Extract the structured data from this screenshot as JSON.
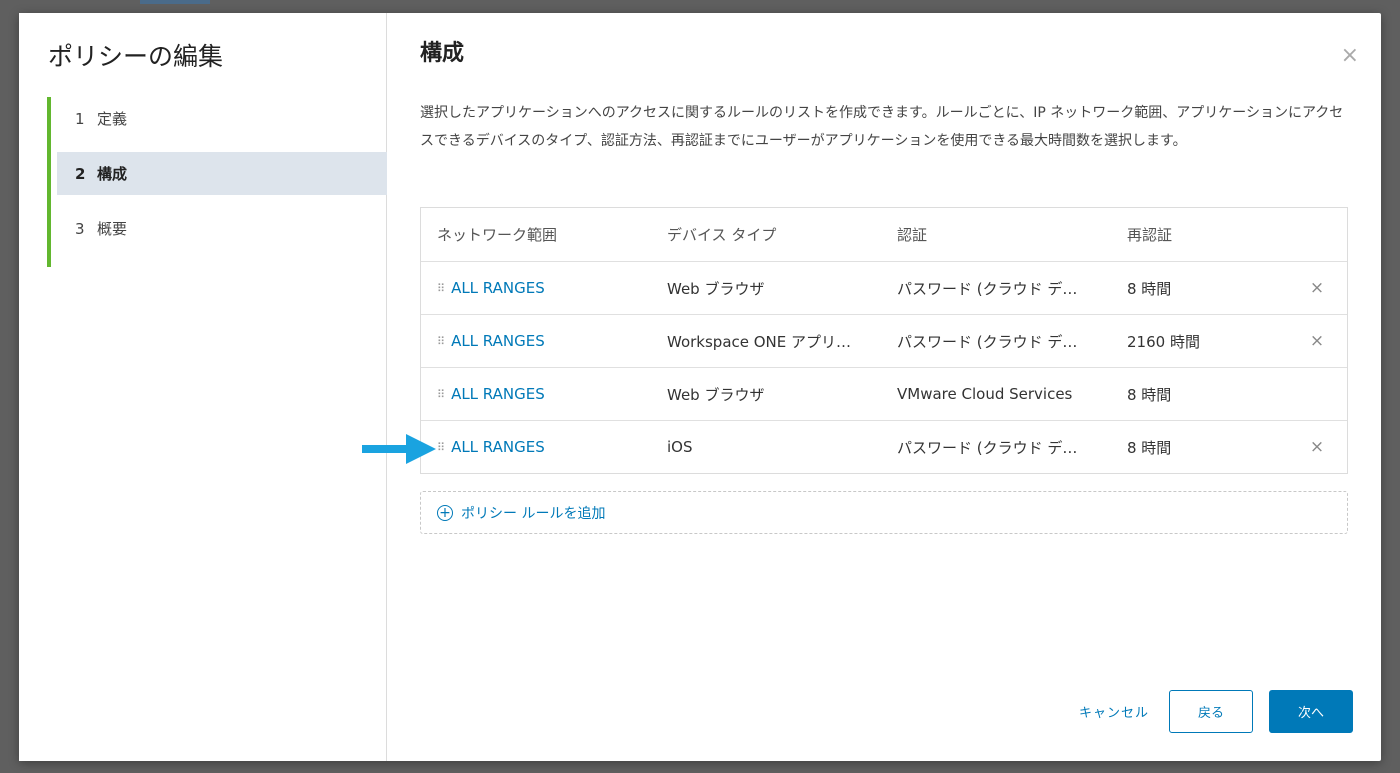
{
  "modal": {
    "title": "ポリシーの編集",
    "steps": [
      {
        "num": "1",
        "label": "定義"
      },
      {
        "num": "2",
        "label": "構成"
      },
      {
        "num": "3",
        "label": "概要"
      }
    ],
    "active_step": 1
  },
  "page": {
    "title": "構成",
    "close_icon": "×",
    "description": "選択したアプリケーションへのアクセスに関するルールのリストを作成できます。ルールごとに、IP ネットワーク範囲、アプリケーションにアクセスできるデバイスのタイプ、認証方法、再認証までにユーザーがアプリケーションを使用できる最大時間数を選択します。"
  },
  "table": {
    "headers": [
      "ネットワーク範囲",
      "デバイス タイプ",
      "認証",
      "再認証"
    ],
    "rows": [
      {
        "range": "ALL RANGES",
        "device": "Web ブラウザ",
        "auth": "パスワード (クラウド デ…",
        "reauth": "8 時間",
        "removable": true
      },
      {
        "range": "ALL RANGES",
        "device": "Workspace ONE アプリ…",
        "auth": "パスワード (クラウド デ…",
        "reauth": "2160 時間",
        "removable": true
      },
      {
        "range": "ALL RANGES",
        "device": "Web ブラウザ",
        "auth": "VMware Cloud Services",
        "reauth": "8 時間",
        "removable": false
      },
      {
        "range": "ALL RANGES",
        "device": "iOS",
        "auth": "パスワード (クラウド デ…",
        "reauth": "8 時間",
        "removable": true
      }
    ]
  },
  "add_rule": {
    "label": "ポリシー ルールを追加"
  },
  "footer": {
    "cancel": "キャンセル",
    "back": "戻る",
    "next": "次へ"
  },
  "icons": {
    "grip": "drag-handle-icon",
    "remove": "close-icon",
    "add": "plus-circle-icon",
    "arrow": "arrow-right-icon"
  },
  "colors": {
    "accent": "#0079b8",
    "stepper_bar": "#62b72f",
    "arrow": "#1aa3e0",
    "active_step_bg": "#dde4ec"
  }
}
